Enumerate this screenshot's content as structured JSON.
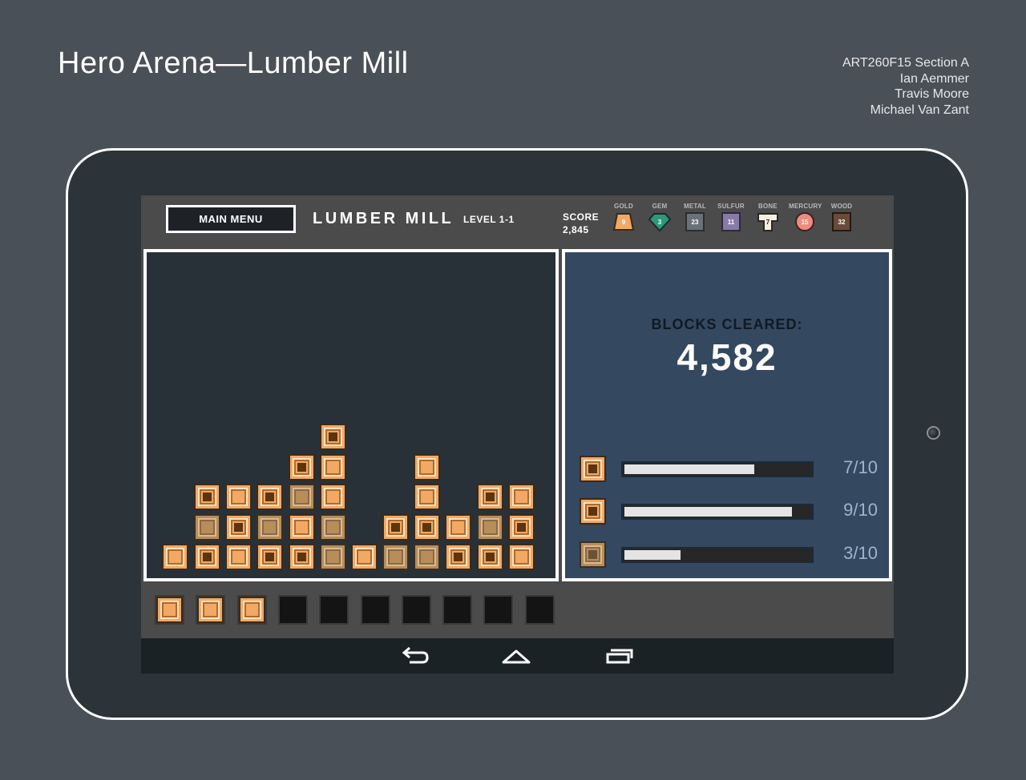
{
  "header": {
    "title": "Hero Arena—Lumber Mill",
    "credits": [
      "ART260F15 Section A",
      "Ian Aemmer",
      "Travis Moore",
      "Michael Van Zant"
    ]
  },
  "game": {
    "main_menu_label": "MAIN MENU",
    "level_name": "LUMBER MILL",
    "level_number": "LEVEL 1-1",
    "score_label": "SCORE",
    "score_value": "2,845",
    "resources": [
      {
        "label": "GOLD",
        "count": "9",
        "color": "#f2a965",
        "icon": "gold-icon"
      },
      {
        "label": "GEM",
        "count": "3",
        "color": "#2a9a7a",
        "icon": "gem-icon"
      },
      {
        "label": "METAL",
        "count": "23",
        "color": "#6b7178",
        "icon": "metal-icon"
      },
      {
        "label": "SULFUR",
        "count": "11",
        "color": "#8a7aa8",
        "icon": "sulfur-icon"
      },
      {
        "label": "BONE",
        "count": "7",
        "color": "#f4efe0",
        "icon": "bone-icon"
      },
      {
        "label": "MERCURY",
        "count": "15",
        "color": "#f08a80",
        "icon": "mercury-icon"
      },
      {
        "label": "WOOD",
        "count": "32",
        "color": "#6a4a3a",
        "icon": "wood-icon"
      }
    ],
    "stats": {
      "blocks_cleared_label": "BLOCKS CLEARED:",
      "blocks_cleared_value": "4,582",
      "goals": [
        {
          "text": "7/10",
          "progress": 0.7,
          "block": "bright"
        },
        {
          "text": "9/10",
          "progress": 0.9,
          "block": "bright"
        },
        {
          "text": "3/10",
          "progress": 0.3,
          "block": "dim"
        }
      ]
    },
    "tray": {
      "filled": 3,
      "total": 10
    },
    "nav": [
      "back-icon",
      "home-icon",
      "recent-apps-icon"
    ]
  }
}
